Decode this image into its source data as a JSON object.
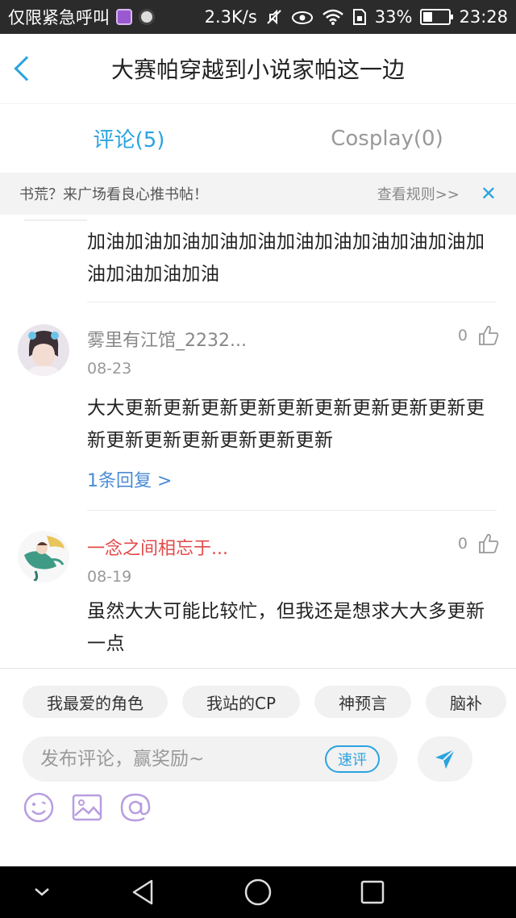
{
  "status_bar": {
    "carrier": "仅限紧急呼叫",
    "speed": "2.3K/s",
    "battery": "33%",
    "time": "23:28"
  },
  "header": {
    "title": "大赛帕穿越到小说家帕这一边"
  },
  "tabs": [
    {
      "label": "评论(5)",
      "active": true
    },
    {
      "label": "Cosplay(0)",
      "active": false
    }
  ],
  "notice": {
    "text": "书荒？来广场看良心推书帖！",
    "link": "查看规则>>"
  },
  "comments": [
    {
      "text": "加油加油加油加油加油加油加油加油加油加油加油加油加油加油"
    },
    {
      "username": "雾里有江馆_2232...",
      "date": "08-23",
      "likes": "0",
      "text": "大大更新更新更新更新更新更新更新更新更新更新更新更新更新更新更新更新",
      "reply": "1条回复 >"
    },
    {
      "username": "一念之间相忘于...",
      "date": "08-19",
      "likes": "0",
      "text": "虽然大大可能比较忙，但我还是想求大大多更新一点"
    }
  ],
  "compose": {
    "chips": [
      "我最爱的角色",
      "我站的CP",
      "神预言",
      "脑补"
    ],
    "placeholder": "发布评论，赢奖励~",
    "quick_label": "速评"
  },
  "colors": {
    "accent": "#2aa3e0",
    "username_red": "#e24a4a",
    "icon_purple": "#b89de0"
  }
}
